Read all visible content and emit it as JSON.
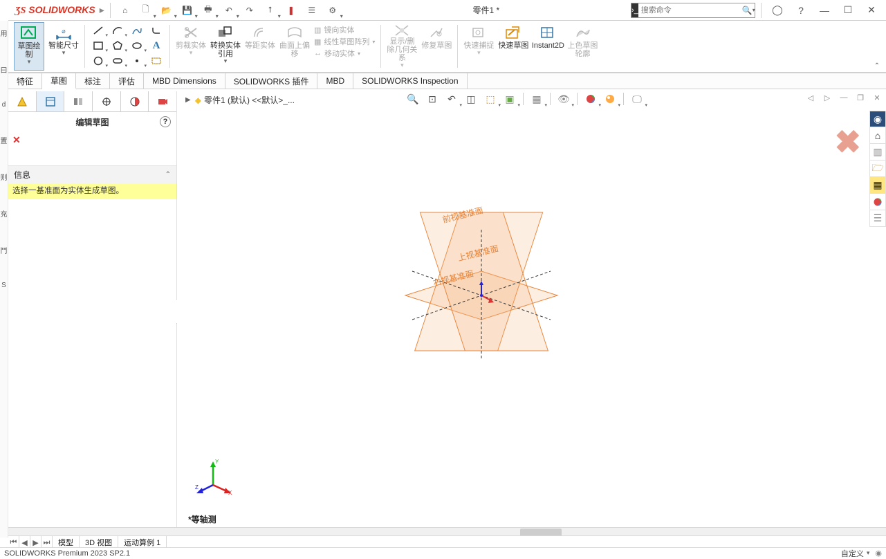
{
  "app": {
    "logo": "SOLIDWORKS",
    "doc_title": "零件1 *"
  },
  "search": {
    "placeholder": "搜索命令"
  },
  "ribbon": {
    "sketch_draw": "草图绘制",
    "smart_dim": "智能尺寸",
    "trim": "剪裁实体",
    "convert": "转换实体引用",
    "offset_ent": "等距实体",
    "offset_surf": "曲面上偏移",
    "mirror": "镜向实体",
    "linear_pattern": "线性草图阵列",
    "move": "移动实体",
    "disp_del_rel": "显示/删除几何关系",
    "repair": "修复草图",
    "quick_snap": "快速捕捉",
    "rapid_sketch": "快速草图",
    "instant2d": "Instant2D",
    "shaded_contour": "上色草图轮廓"
  },
  "tabs": {
    "feature": "特征",
    "sketch": "草图",
    "annotate": "标注",
    "evaluate": "评估",
    "mbd_dim": "MBD Dimensions",
    "addins": "SOLIDWORKS 插件",
    "mbd": "MBD",
    "inspection": "SOLIDWORKS Inspection"
  },
  "pm": {
    "title": "编辑草图",
    "info_head": "信息",
    "info_body": "选择一基准面为实体生成草图。"
  },
  "crumb": {
    "part": "零件1 (默认) <<默认>_..."
  },
  "planes": {
    "front": "前视基准面",
    "top": "上视基准面",
    "right_plane": "右视基准面"
  },
  "viewname": "*等轴测",
  "triad": {
    "x": "X",
    "y": "Y",
    "z": "Z"
  },
  "bottom_tabs": {
    "model": "模型",
    "v3d": "3D 视图",
    "motion": "运动算例 1"
  },
  "status": {
    "left": "SOLIDWORKS Premium 2023 SP2.1",
    "right": "自定义"
  },
  "leftgutter": [
    "用",
    "曰",
    "d",
    "置",
    "则",
    "充",
    "鬥",
    "S"
  ]
}
